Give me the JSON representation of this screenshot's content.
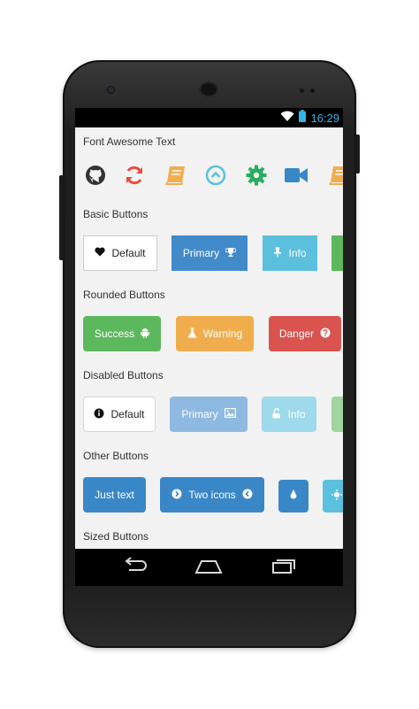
{
  "status_bar": {
    "time": "16:29"
  },
  "sections": {
    "font_awesome": "Font Awesome Text",
    "basic": "Basic Buttons",
    "rounded": "Rounded Buttons",
    "disabled": "Disabled Buttons",
    "other": "Other Buttons",
    "sized": "Sized Buttons"
  },
  "icons": [
    {
      "name": "github-icon",
      "color": "#333333"
    },
    {
      "name": "refresh-icon",
      "color": "#e74c3c"
    },
    {
      "name": "book-icon",
      "color": "#f0ad4e"
    },
    {
      "name": "chevron-circle-up-icon",
      "color": "#5bc0de"
    },
    {
      "name": "gear-icon",
      "color": "#27ae60"
    },
    {
      "name": "video-camera-icon",
      "color": "#3a87c8"
    },
    {
      "name": "book-icon",
      "color": "#f0ad4e"
    }
  ],
  "basic_buttons": {
    "default": {
      "label": "Default",
      "icon": "heart-icon"
    },
    "primary": {
      "label": "Primary",
      "icon": "trophy-icon",
      "color": "#428bca"
    },
    "info": {
      "label": "Info",
      "icon": "pin-icon",
      "color": "#5bc0de"
    },
    "success_partial_color": "#5cb85c"
  },
  "rounded_buttons": {
    "success": {
      "label": "Success",
      "icon": "android-icon",
      "color": "#5cb85c"
    },
    "warning": {
      "label": "Warning",
      "icon": "flask-icon",
      "color": "#f0ad4e"
    },
    "danger": {
      "label": "Danger",
      "icon": "question-circle-icon",
      "color": "#d9534f"
    }
  },
  "disabled_buttons": {
    "default": {
      "label": "Default",
      "icon": "info-circle-icon"
    },
    "primary": {
      "label": "Primary",
      "icon": "picture-icon",
      "color": "#8eb9e0"
    },
    "info": {
      "label": "Info",
      "icon": "unlock-icon",
      "color": "#9fd9ec"
    },
    "success_partial_color": "#9fd49f"
  },
  "other_buttons": {
    "just_text": {
      "label": "Just text",
      "color": "#3a87c8"
    },
    "two_icons": {
      "label": "Two icons",
      "left_icon": "chevron-circle-right-icon",
      "right_icon": "chevron-circle-left-icon",
      "color": "#3a87c8"
    },
    "icon_only": {
      "icon": "drop-icon",
      "color": "#3a87c8"
    },
    "partial": {
      "icon": "sun-icon",
      "color": "#5bc0de"
    }
  },
  "nav_bar": {
    "back": "back-icon",
    "home": "home-icon",
    "recents": "recents-icon"
  }
}
